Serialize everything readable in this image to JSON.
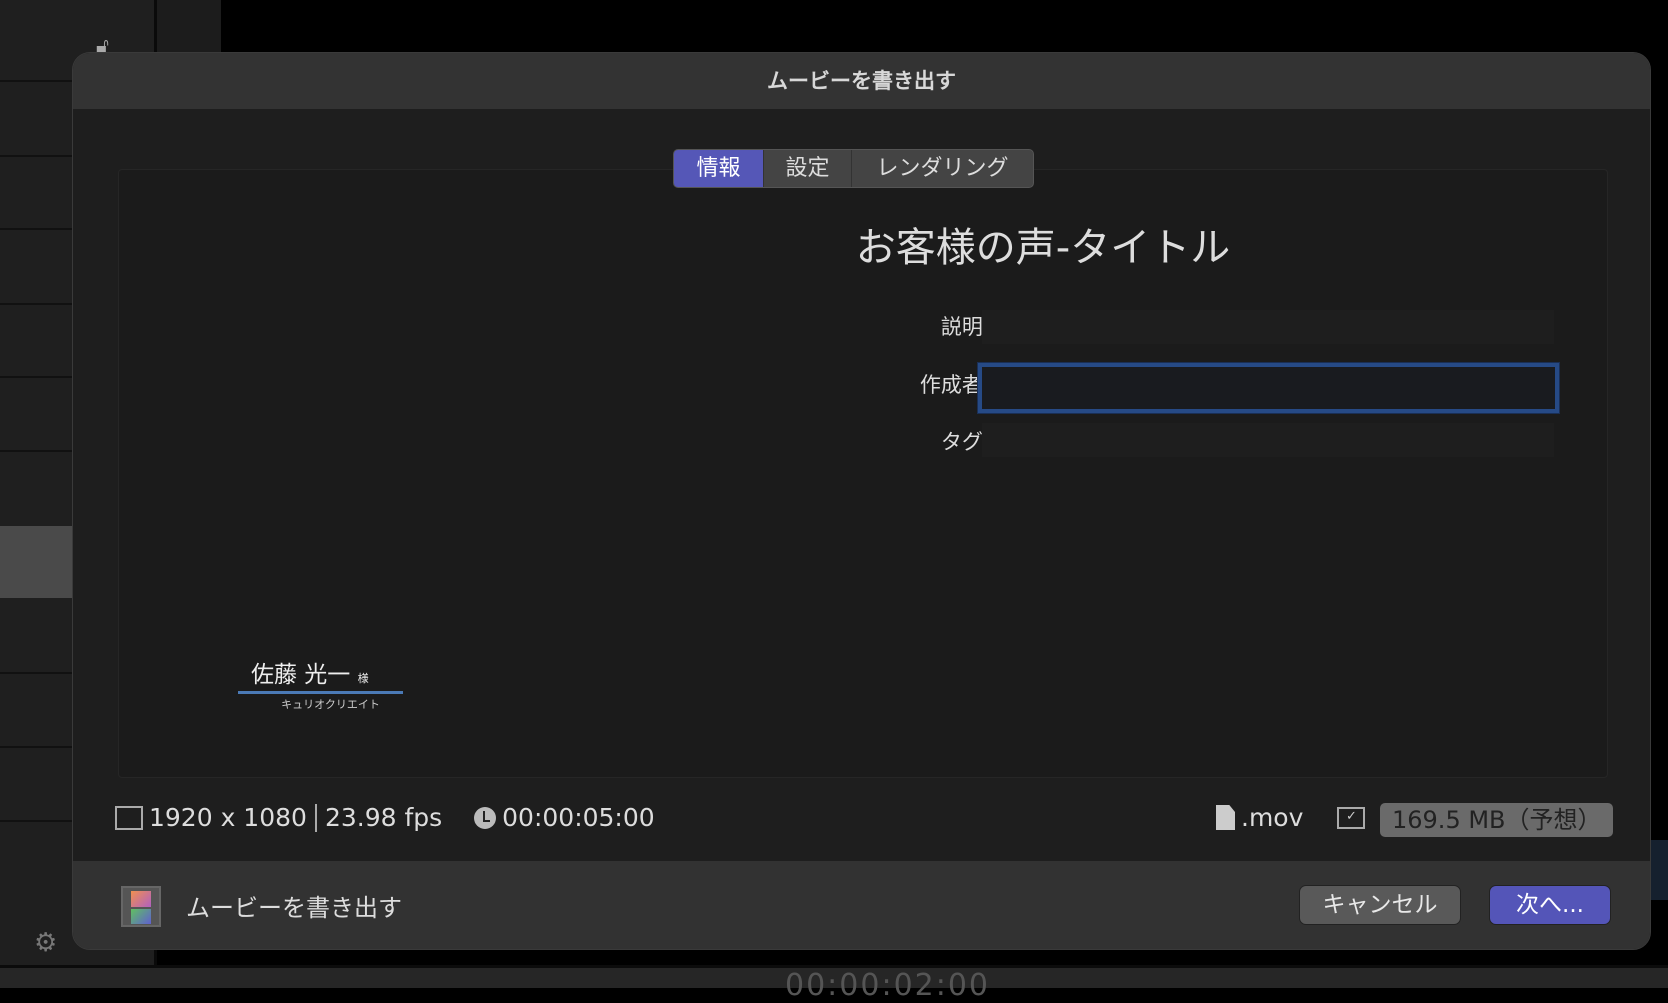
{
  "dialog": {
    "title": "ムービーを書き出す"
  },
  "tabs": [
    {
      "label": "情報",
      "active": true
    },
    {
      "label": "設定",
      "active": false
    },
    {
      "label": "レンダリング",
      "active": false
    }
  ],
  "project_title": "お客様の声-タイトル",
  "fields": {
    "description": {
      "label": "説明:",
      "value": ""
    },
    "author": {
      "label": "作成者:",
      "value": ""
    },
    "tags": {
      "label": "タグ:",
      "value": ""
    }
  },
  "preview": {
    "name": "佐藤 光一",
    "honorific": "様",
    "company": "キュリオクリエイト"
  },
  "info": {
    "resolution": "1920 x 1080",
    "framerate": "23.98 fps",
    "duration": "00:00:05:00",
    "format": ".mov",
    "size": "169.5 MB（予想）"
  },
  "footer": {
    "label": "ムービーを書き出す",
    "cancel": "キャンセル",
    "next": "次へ..."
  },
  "background": {
    "timecode": "00:00:02:00"
  },
  "colors": {
    "accent": "#5455b8",
    "focus": "#264a86"
  }
}
